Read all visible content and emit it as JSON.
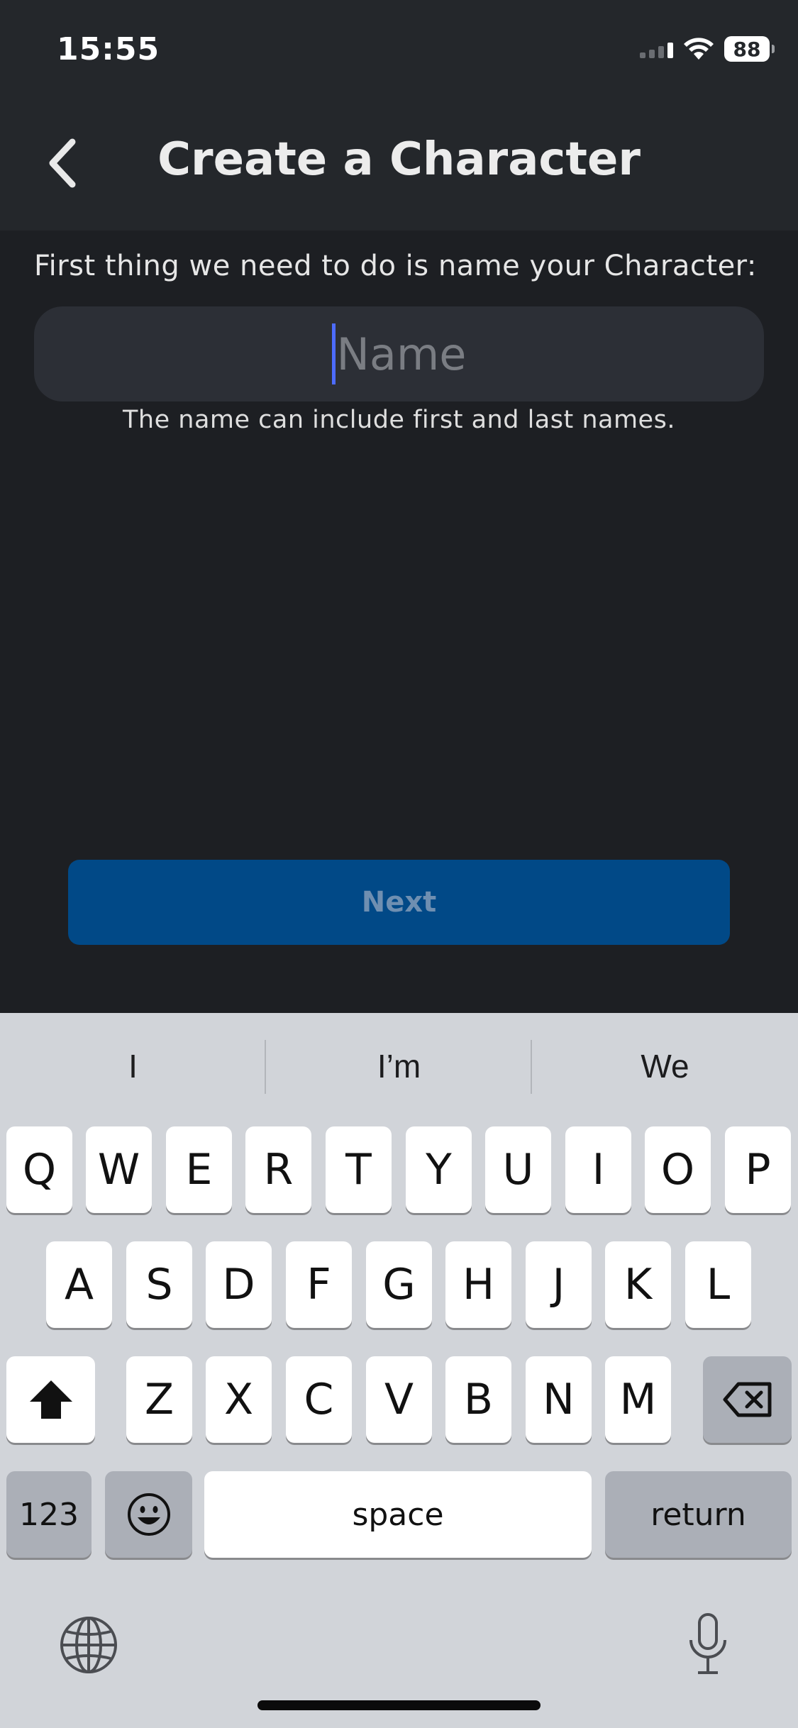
{
  "status_bar": {
    "time": "15:55",
    "battery": "88"
  },
  "nav": {
    "title": "Create a Character",
    "back_icon": "chevron-left-icon"
  },
  "form": {
    "prompt": "First thing we need to do is name your Character:",
    "name_placeholder": "Name",
    "name_value": "",
    "hint": "The name can include first and last names.",
    "next_label": "Next"
  },
  "keyboard": {
    "suggestions": [
      "I",
      "I’m",
      "We"
    ],
    "row1": [
      "Q",
      "W",
      "E",
      "R",
      "T",
      "Y",
      "U",
      "I",
      "O",
      "P"
    ],
    "row2": [
      "A",
      "S",
      "D",
      "F",
      "G",
      "H",
      "J",
      "K",
      "L"
    ],
    "row3": [
      "Z",
      "X",
      "C",
      "V",
      "B",
      "N",
      "M"
    ],
    "numbers_label": "123",
    "space_label": "space",
    "return_label": "return"
  },
  "colors": {
    "background": "#1d1f23",
    "header": "#24272b",
    "input": "#2c2f36",
    "accent_caret": "#4d6cff",
    "next_button": "#014987",
    "keyboard": "#d1d4d9"
  }
}
